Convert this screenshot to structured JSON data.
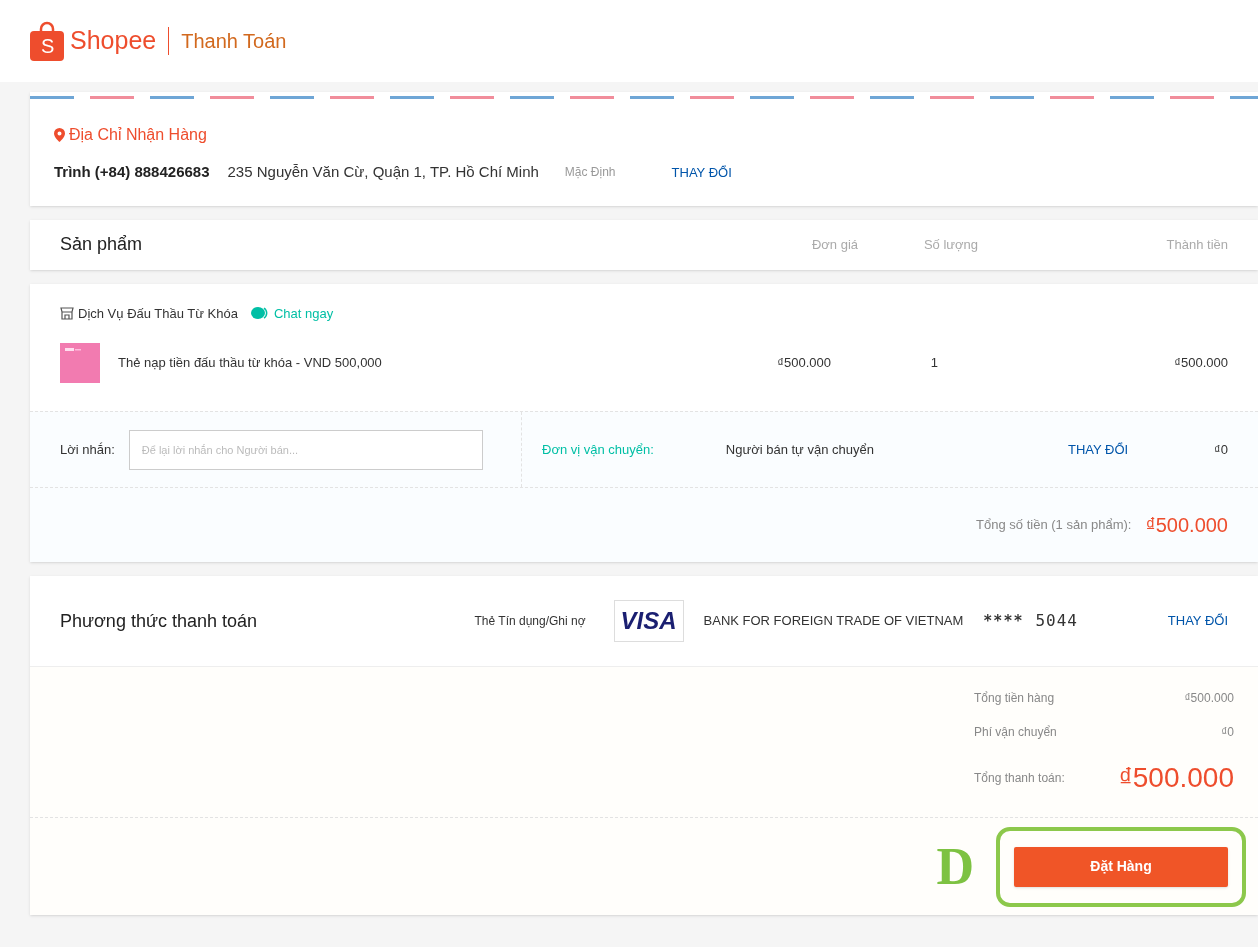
{
  "header": {
    "logo_letter": "S",
    "brand": "Shopee",
    "page_title": "Thanh Toán"
  },
  "address": {
    "title": "Địa Chỉ Nhận Hàng",
    "name_phone": "Trình (+84) 888426683",
    "address": "235 Nguyễn Văn Cừ, Quận 1, TP. Hồ Chí Minh",
    "tag": "Mặc Định",
    "change": "THAY ĐỔI"
  },
  "products_header": {
    "title": "Sản phẩm",
    "columns": [
      "Đơn giá",
      "Số lượng",
      "Thành tiền"
    ]
  },
  "shop": {
    "name": "Dịch Vụ Đấu Thầu Từ Khóa",
    "chat": "Chat ngay"
  },
  "items": [
    {
      "name": "Thẻ nạp tiền đấu thầu từ khóa - VND 500,000",
      "unit_price": "₫500.000",
      "quantity": "1",
      "subtotal": "₫500.000"
    }
  ],
  "message": {
    "label": "Lời nhắn:",
    "placeholder": "Để lại lời nhắn cho Người bán..."
  },
  "shipping": {
    "label": "Đơn vị vận chuyển:",
    "method": "Người bán tự vận chuyển",
    "change": "THAY ĐỔI",
    "fee": "₫0"
  },
  "order_total": {
    "label": "Tổng số tiền (1 sản phẩm):",
    "amount": "₫500.000"
  },
  "payment": {
    "title": "Phương thức thanh toán",
    "type": "Thẻ Tín dụng/Ghi nợ",
    "card_brand": "VISA",
    "bank": "BANK FOR FOREIGN TRADE OF VIETNAM",
    "mask": "****",
    "last4": "5044",
    "change": "THAY ĐỔI"
  },
  "summary": [
    {
      "kind": "line",
      "label": "Tổng tiền hàng",
      "value": "₫500.000"
    },
    {
      "kind": "line",
      "label": "Phí vận chuyển",
      "value": "₫0"
    },
    {
      "kind": "grand",
      "label": "Tổng thanh toán:",
      "value": "₫500.000"
    }
  ],
  "place_order": {
    "label": "Đặt Hàng"
  },
  "annotation": {
    "letter": "D"
  }
}
